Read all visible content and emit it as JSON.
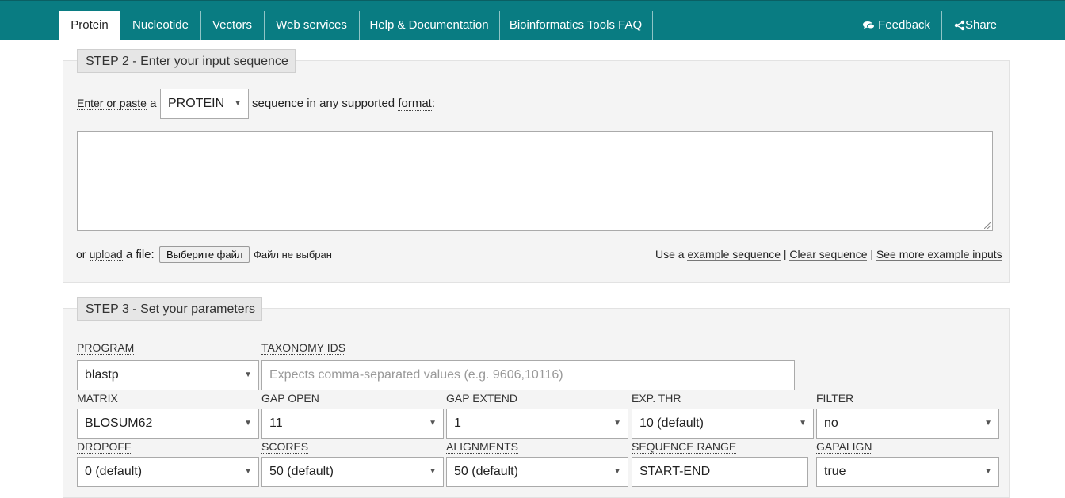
{
  "nav": {
    "tabs": [
      {
        "label": "Protein"
      },
      {
        "label": "Nucleotide"
      },
      {
        "label": "Vectors"
      },
      {
        "label": "Web services"
      },
      {
        "label": "Help & Documentation"
      },
      {
        "label": "Bioinformatics Tools FAQ"
      }
    ],
    "feedback_label": "Feedback",
    "share_label": "Share"
  },
  "step2": {
    "title": "STEP 2 - Enter your input sequence",
    "enter_or_paste": "Enter or paste",
    "a": "a",
    "seq_type": "PROTEIN",
    "sequence_in": "sequence in any supported",
    "format": "format",
    "colon": ":",
    "or": "or",
    "upload": "upload",
    "a_file": "a file:",
    "choose_file": "Выберите файл",
    "no_file": "Файл не выбран",
    "use_a": "Use a",
    "example_sequence": "example sequence",
    "pipe": "|",
    "clear_sequence": "Clear sequence",
    "see_more": "See more example inputs"
  },
  "step3": {
    "title": "STEP 3 - Set your parameters",
    "program": {
      "label": "PROGRAM",
      "value": "blastp"
    },
    "taxonomy": {
      "label": "TAXONOMY IDS",
      "placeholder": "Expects comma-separated values (e.g. 9606,10116)"
    },
    "matrix": {
      "label": "MATRIX",
      "value": "BLOSUM62"
    },
    "gap_open": {
      "label": "GAP OPEN",
      "value": "11"
    },
    "gap_extend": {
      "label": "GAP EXTEND",
      "value": "1"
    },
    "exp_thr": {
      "label": "EXP. THR",
      "value": "10 (default)"
    },
    "filter": {
      "label": "FILTER",
      "value": "no"
    },
    "dropoff": {
      "label": "DROPOFF",
      "value": "0 (default)"
    },
    "scores": {
      "label": "SCORES",
      "value": "50 (default)"
    },
    "alignments": {
      "label": "ALIGNMENTS",
      "value": "50 (default)"
    },
    "seq_range": {
      "label": "SEQUENCE RANGE",
      "value": "START-END"
    },
    "gapalign": {
      "label": "GAPALIGN",
      "value": "true"
    }
  },
  "colors": {
    "nav_bg": "#097c82",
    "panel_bg": "#f4f4f4"
  },
  "icons": [
    "comments-icon",
    "share-icon",
    "caret-down-icon"
  ]
}
